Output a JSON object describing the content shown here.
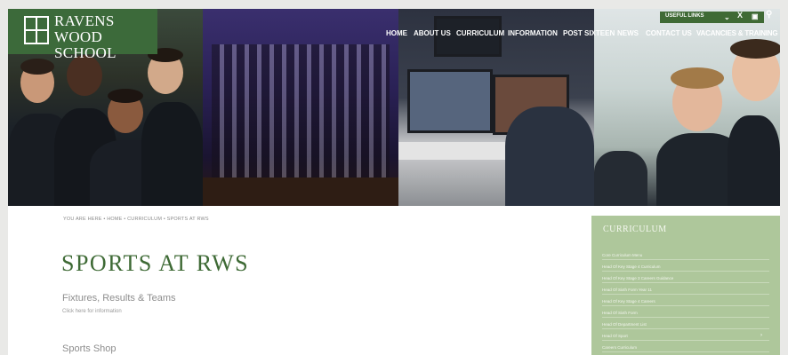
{
  "school": {
    "name_line1": "RAVENS WOOD",
    "name_line2": "SCHOOL"
  },
  "top_bar": {
    "useful_links": "USEFUL LINKS"
  },
  "nav": {
    "items": [
      "HOME",
      "ABOUT US",
      "CURRICULUM",
      "INFORMATION",
      "POST SIXTEEN",
      "NEWS",
      "CONTACT US",
      "VACANCIES & TRAINING"
    ]
  },
  "breadcrumb": "YOU ARE HERE  •  HOME  •  CURRICULUM  •  SPORTS AT RWS",
  "page": {
    "title": "SPORTS AT RWS",
    "section1_heading": "Fixtures, Results & Teams",
    "section1_link": "Click here for information",
    "section2_heading": "Sports Shop"
  },
  "sidebar": {
    "title": "CURRICULUM",
    "items": [
      "Core Curriculum Menu",
      "Head Of Key Stage 4 Curriculum",
      "Head Of Key Stage 3 Careers Guidance",
      "Head Of Sixth Form Year 11",
      "Head Of Key Stage 4 Careers",
      "Head Of Sixth Form",
      "Head Of Department List",
      "Head Of Sport",
      "Careers Curriculum"
    ]
  },
  "colors": {
    "brand_green": "#3e6a35",
    "sidebar_green": "#aec79b"
  }
}
